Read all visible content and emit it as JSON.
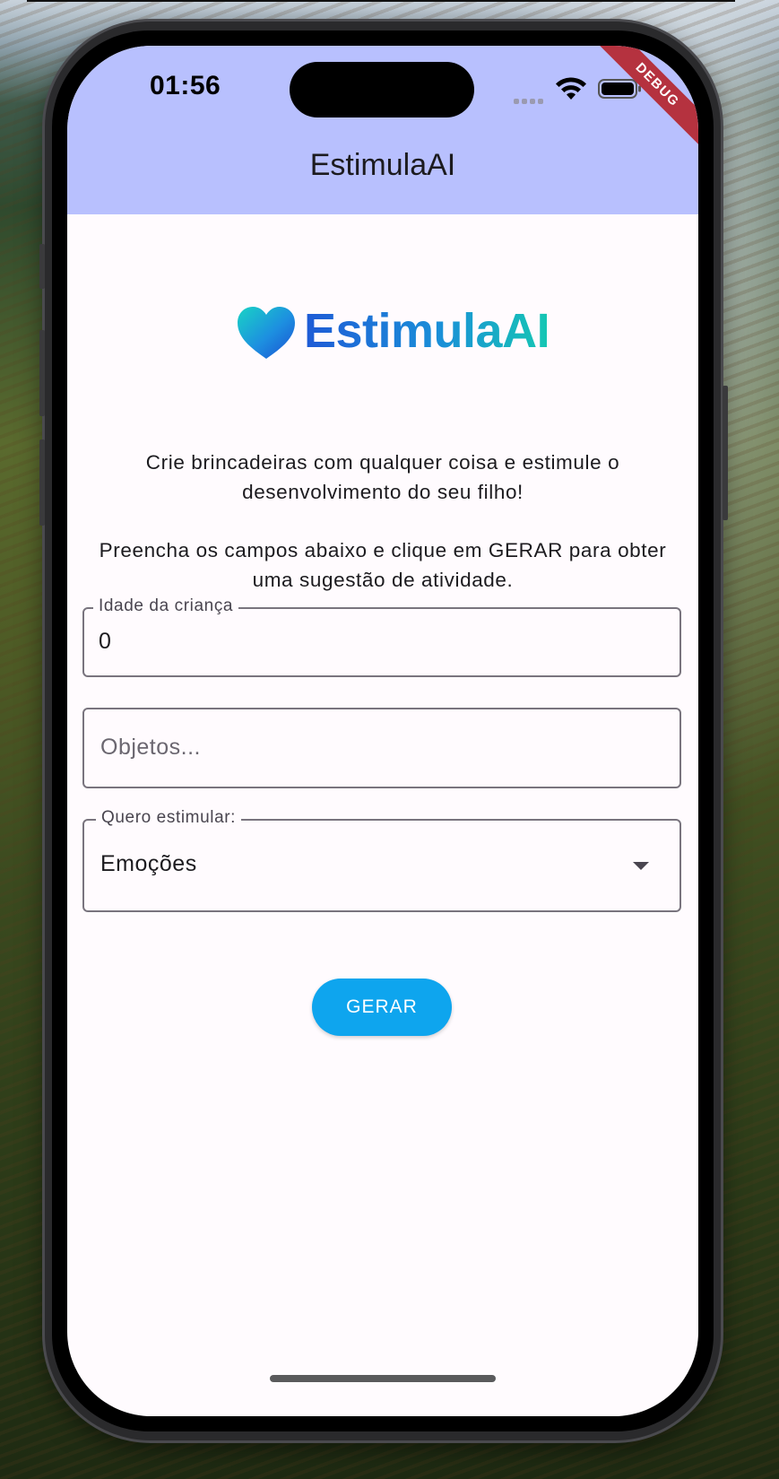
{
  "status_bar": {
    "time": "01:56",
    "debug_badge": "DEBUG"
  },
  "appbar": {
    "title": "EstimulaAI",
    "color": "#b8c0fe"
  },
  "logo": {
    "text": "EstimulaAI",
    "icon": "heart-icon"
  },
  "intro": {
    "line1": "Crie brincadeiras com qualquer coisa e estimule o desenvolvimento do seu filho!",
    "line2": "Preencha os campos abaixo e clique em GERAR para obter uma sugestão de atividade."
  },
  "form": {
    "age": {
      "label": "Idade da criança",
      "value": "0"
    },
    "objects": {
      "placeholder": "Objetos..."
    },
    "stimulate": {
      "label": "Quero estimular:",
      "selected": "Emoções"
    },
    "submit_label": "GERAR",
    "submit_color": "#0ea5ee"
  }
}
